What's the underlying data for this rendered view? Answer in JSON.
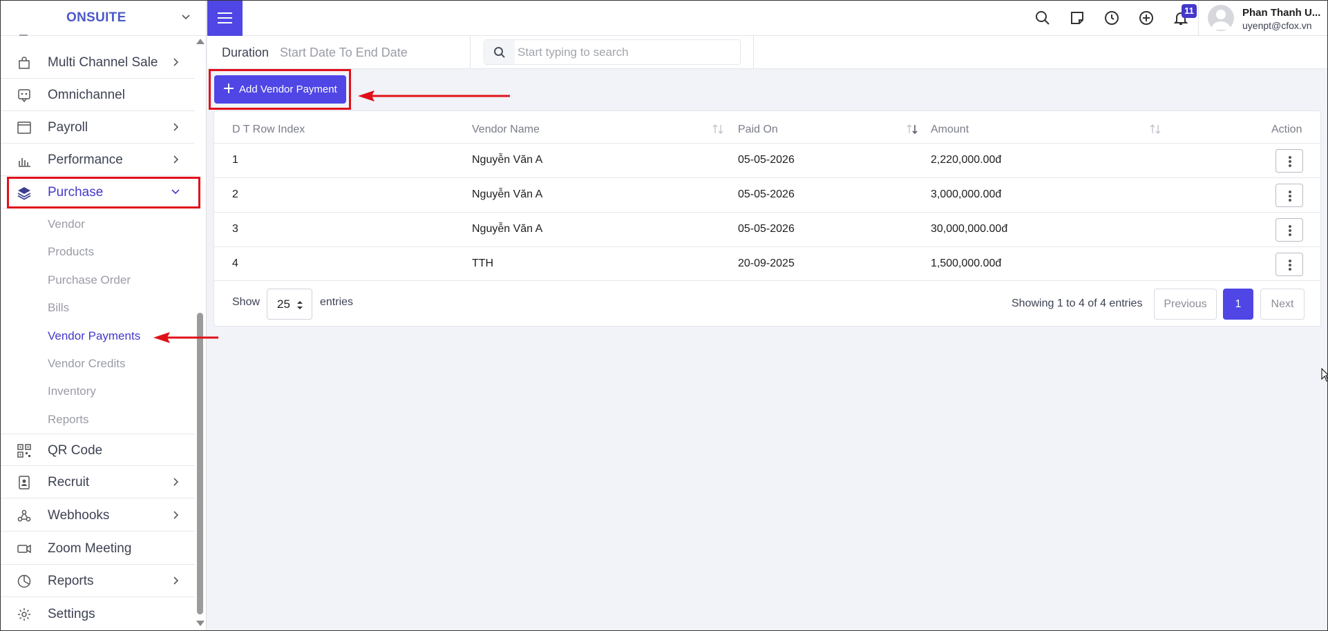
{
  "brand": {
    "name": "ONSUITE"
  },
  "sidebar": {
    "items": [
      {
        "label": "Multi Channel Sale",
        "icon": "shopping-bag-icon",
        "has_children": true
      },
      {
        "label": "Omnichannel",
        "icon": "chat-icon",
        "has_children": false
      },
      {
        "label": "Payroll",
        "icon": "browser-window-icon",
        "has_children": true
      },
      {
        "label": "Performance",
        "icon": "bar-chart-icon",
        "has_children": true
      },
      {
        "label": "Purchase",
        "icon": "layers-icon",
        "has_children": true,
        "expanded": true,
        "active": true
      },
      {
        "label": "QR Code",
        "icon": "qr-code-icon",
        "has_children": false
      },
      {
        "label": "Recruit",
        "icon": "id-badge-icon",
        "has_children": true
      },
      {
        "label": "Webhooks",
        "icon": "webhook-icon",
        "has_children": true
      },
      {
        "label": "Zoom Meeting",
        "icon": "video-camera-icon",
        "has_children": false
      },
      {
        "label": "Reports",
        "icon": "pie-chart-icon",
        "has_children": true
      },
      {
        "label": "Settings",
        "icon": "gear-icon",
        "has_children": false
      }
    ],
    "purchase_sub": [
      {
        "label": "Vendor"
      },
      {
        "label": "Products"
      },
      {
        "label": "Purchase Order"
      },
      {
        "label": "Bills"
      },
      {
        "label": "Vendor Payments",
        "active": true
      },
      {
        "label": "Vendor Credits"
      },
      {
        "label": "Inventory"
      },
      {
        "label": "Reports"
      }
    ]
  },
  "header": {
    "notification_count": "11",
    "user_name": "Phan Thanh U...",
    "user_email": "uyenpt@cfox.vn"
  },
  "filter": {
    "duration_label": "Duration",
    "date_range": "Start Date To End Date",
    "search_placeholder": "Start typing to search"
  },
  "toolbar": {
    "add_label": "Add Vendor Payment"
  },
  "table": {
    "columns": [
      "D T Row Index",
      "Vendor Name",
      "Paid On",
      "Amount",
      "Action"
    ],
    "rows": [
      {
        "index": "1",
        "vendor": "Nguyễn Văn A",
        "paid_on": "05-05-2026",
        "amount": "2,220,000.00đ"
      },
      {
        "index": "2",
        "vendor": "Nguyễn Văn A",
        "paid_on": "05-05-2026",
        "amount": "3,000,000.00đ"
      },
      {
        "index": "3",
        "vendor": "Nguyễn Văn A",
        "paid_on": "05-05-2026",
        "amount": "30,000,000.00đ"
      },
      {
        "index": "4",
        "vendor": "TTH",
        "paid_on": "20-09-2025",
        "amount": "1,500,000.00đ"
      }
    ]
  },
  "pagination": {
    "show_label": "Show",
    "page_size": "25",
    "entries_label": "entries",
    "summary": "Showing 1 to 4 of 4 entries",
    "previous": "Previous",
    "current_page": "1",
    "next": "Next"
  },
  "colors": {
    "accent": "#4f46e5",
    "annotation_red": "#e0101a",
    "active_text": "#4338ca"
  }
}
